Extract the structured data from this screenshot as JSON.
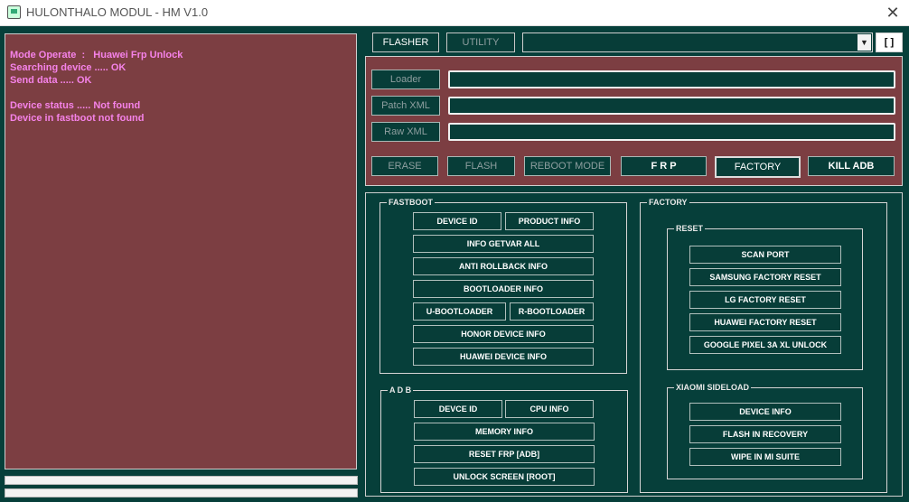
{
  "window": {
    "title": "HULONTHALO MODUL - HM V1.0",
    "close": "✕"
  },
  "log": {
    "lines": [
      "Mode Operate  :   Huawei Frp Unlock",
      "Searching device ..... OK",
      "Send data ..... OK",
      "",
      "Device status ..... Not found",
      "Device in fastboot not found"
    ]
  },
  "tabs": {
    "flasher": "FLASHER",
    "utility": "UTILITY"
  },
  "combo": {
    "value": "",
    "arrow": "▼"
  },
  "square_button": "[ ]",
  "flasher": {
    "loader": "Loader",
    "patch_xml": "Patch XML",
    "raw_xml": "Raw XML",
    "erase": "ERASE",
    "flash": "FLASH",
    "reboot_mode": "REBOOT MODE",
    "frp": "F R P",
    "factory": "FACTORY",
    "kill_adb": "KILL  ADB"
  },
  "fastboot": {
    "label": "FASTBOOT",
    "device_id": "DEVICE ID",
    "product_info": "PRODUCT INFO",
    "info_getvar_all": "INFO GETVAR ALL",
    "anti_rollback_info": "ANTI ROLLBACK INFO",
    "bootloader_info": "BOOTLOADER INFO",
    "u_bootloader": "U-BOOTLOADER",
    "r_bootloader": "R-BOOTLOADER",
    "honor_device_info": "HONOR DEVICE INFO",
    "huawei_device_info": "HUAWEI DEVICE INFO"
  },
  "adb": {
    "label": "A D B",
    "devce_id": "DEVCE ID",
    "cpu_info": "CPU INFO",
    "memory_info": "MEMORY INFO",
    "reset_frp": "RESET FRP [ADB]",
    "unlock_screen": "UNLOCK SCREEN  [ROOT]"
  },
  "factory": {
    "label": "FACTORY",
    "reset": {
      "label": "RESET",
      "scan_port": "SCAN PORT",
      "samsung_factory_reset": "SAMSUNG FACTORY RESET",
      "lg_factory_reset": "LG  FACTORY RESET",
      "huawei_factory_reset": "HUAWEI FACTORY RESET",
      "google_pixel_unlock": "GOOGLE PIXEL 3A XL UNLOCK"
    },
    "xiaomi": {
      "label": "XIAOMI SIDELOAD",
      "device_info": "DEVICE INFO",
      "flash_in_recovery": "FLASH IN RECOVERY",
      "wipe_in_mi_suite": "WIPE IN MI  SUITE"
    }
  }
}
